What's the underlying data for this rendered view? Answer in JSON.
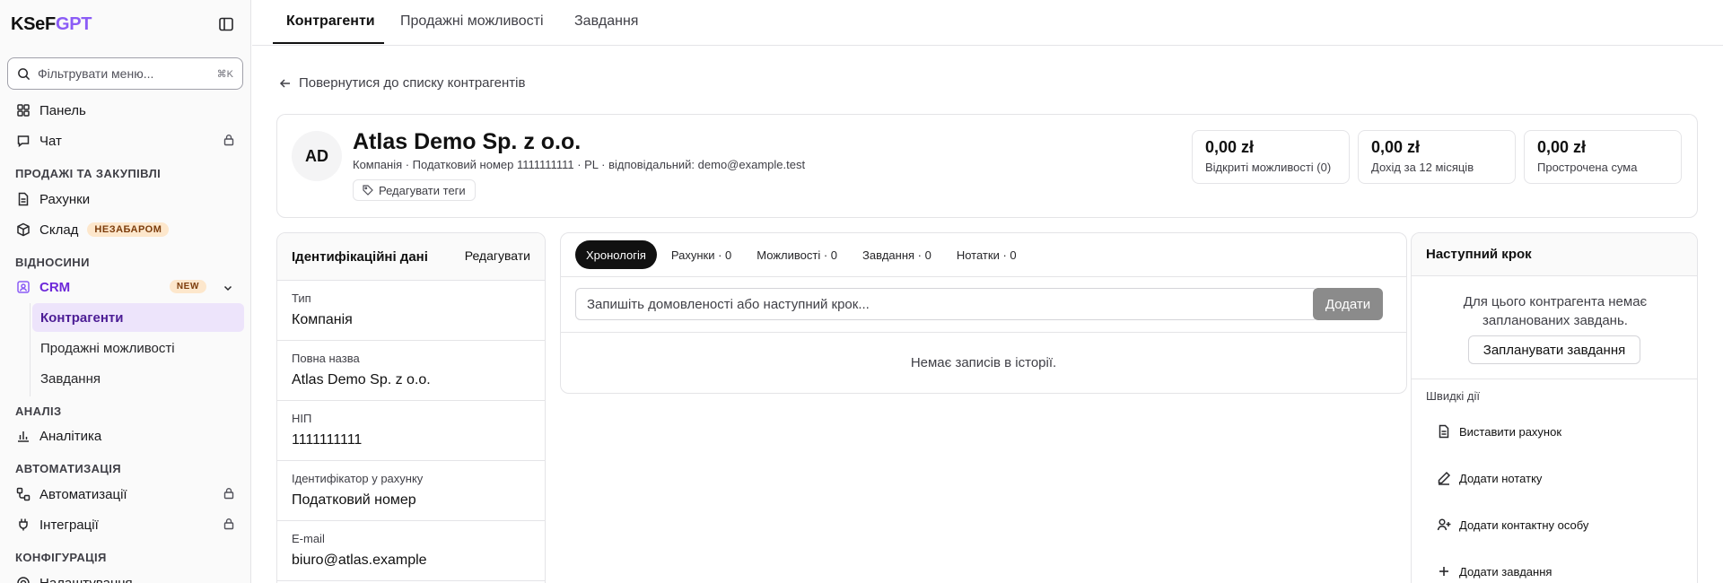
{
  "brand": {
    "part1": "KSeF",
    "part2": "GPT"
  },
  "sidebar": {
    "search_placeholder": "Фільтрувати меню...",
    "search_shortcut": "⌘K",
    "panel": "Панель",
    "chat": "Чат",
    "section_sales": "ПРОДАЖІ ТА ЗАКУПІВЛІ",
    "invoices": "Рахунки",
    "warehouse": "Склад",
    "warehouse_badge": "НЕЗАБАРОМ",
    "section_relations": "ВІДНОСИНИ",
    "crm": "CRM",
    "crm_badge": "NEW",
    "crm_items": [
      "Контрагенти",
      "Продажні можливості",
      "Завдання"
    ],
    "section_analysis": "АНАЛІЗ",
    "analytics": "Аналітика",
    "section_automation": "АВТОМАТИЗАЦІЯ",
    "automations": "Автоматизації",
    "integrations": "Інтеграції",
    "section_config": "КОНФІГУРАЦІЯ",
    "settings": "Налаштування"
  },
  "top_tabs": [
    "Контрагенти",
    "Продажні можливості",
    "Завдання"
  ],
  "back_link": "Повернутися до списку контрагентів",
  "contractor": {
    "initials": "AD",
    "name": "Atlas Demo Sp. z o.o.",
    "meta": "Компанія · Податковий номер 1111111111 · PL · відповідальний: demo@example.test",
    "edit_tags": "Редагувати теги",
    "stats": [
      {
        "value": "0,00 zł",
        "label": "Відкриті можливості (0)"
      },
      {
        "value": "0,00 zł",
        "label": "Дохід за 12 місяців"
      },
      {
        "value": "0,00 zł",
        "label": "Прострочена сума"
      }
    ]
  },
  "identification": {
    "title": "Ідентифікаційні дані",
    "edit": "Редагувати",
    "fields": [
      {
        "key": "Тип",
        "value": "Компанія"
      },
      {
        "key": "Повна назва",
        "value": "Atlas Demo Sp. z o.o."
      },
      {
        "key": "НІП",
        "value": "1111111111"
      },
      {
        "key": "Ідентифікатор у рахунку",
        "value": "Податковий номер"
      },
      {
        "key": "E-mail",
        "value": "biuro@atlas.example"
      }
    ]
  },
  "timeline": {
    "tabs": [
      "Хронологія",
      "Рахунки · 0",
      "Можливості · 0",
      "Завдання · 0",
      "Нотатки · 0"
    ],
    "input_placeholder": "Запишіть домовленості або наступний крок...",
    "add_button": "Додати",
    "empty": "Немає записів в історії."
  },
  "next_step": {
    "title": "Наступний крок",
    "message": "Для цього контрагента немає запланованих завдань.",
    "plan_button": "Запланувати завдання",
    "quick_title": "Швидкі дії",
    "quick_actions": [
      "Виставити рахунок",
      "Додати нотатку",
      "Додати контактну особу",
      "Додати завдання"
    ]
  },
  "colors": {
    "accent": "#8b5cf6",
    "active_bg": "#ede4fb",
    "badge_bg": "#fde7cc"
  }
}
